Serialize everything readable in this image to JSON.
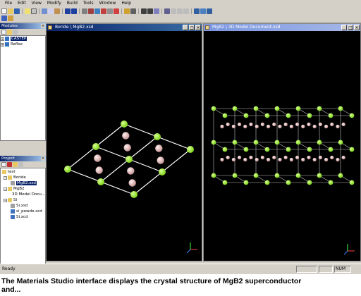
{
  "menu": [
    "File",
    "Edit",
    "View",
    "Modify",
    "Build",
    "Tools",
    "Window",
    "Help"
  ],
  "modules_panel": {
    "title": "Modules",
    "items": [
      {
        "label": "CASTEP",
        "selected": true
      },
      {
        "label": "Reflex",
        "selected": false
      }
    ]
  },
  "project_panel": {
    "title": "Project",
    "items": [
      {
        "label": "test",
        "level": 0,
        "icon": "project-icon"
      },
      {
        "label": "Boride",
        "level": 1,
        "icon": "folder-icon"
      },
      {
        "label": "MgB2.xsd",
        "level": 2,
        "icon": "structure-file-icon",
        "selected": true
      },
      {
        "label": "MgB2",
        "level": 1,
        "icon": "folder-icon"
      },
      {
        "label": "3D Model Docu...",
        "level": 2,
        "icon": "structure-file-icon"
      },
      {
        "label": "Si",
        "level": 1,
        "icon": "folder-icon"
      },
      {
        "label": "Si.xsd",
        "level": 2,
        "icon": "structure-file-icon"
      },
      {
        "label": "si_powde.xcd",
        "level": 2,
        "icon": "chart-file-icon"
      },
      {
        "label": "Si.xcd",
        "level": 2,
        "icon": "chart-file-icon"
      }
    ]
  },
  "documents": [
    {
      "title": "Boride \\ MgB2.xsd",
      "active": true
    },
    {
      "title": "MgB2 \\ 3D Model Document.xsd",
      "active": false
    }
  ],
  "window_buttons": {
    "minimize": "_",
    "maximize": "□",
    "close": "×"
  },
  "status": {
    "left": "Ready",
    "right": "NUM"
  },
  "caption": {
    "line1": "The Materials Studio interface displays the crystal structure of MgB2 superconductor",
    "line2": "and..."
  },
  "colors": {
    "magnesium_atom": "#7fd41e",
    "boron_atom": "#e8b8b8",
    "bond": "#ffffff",
    "viewport_bg": "#000000",
    "title_active": "#0a246a"
  }
}
